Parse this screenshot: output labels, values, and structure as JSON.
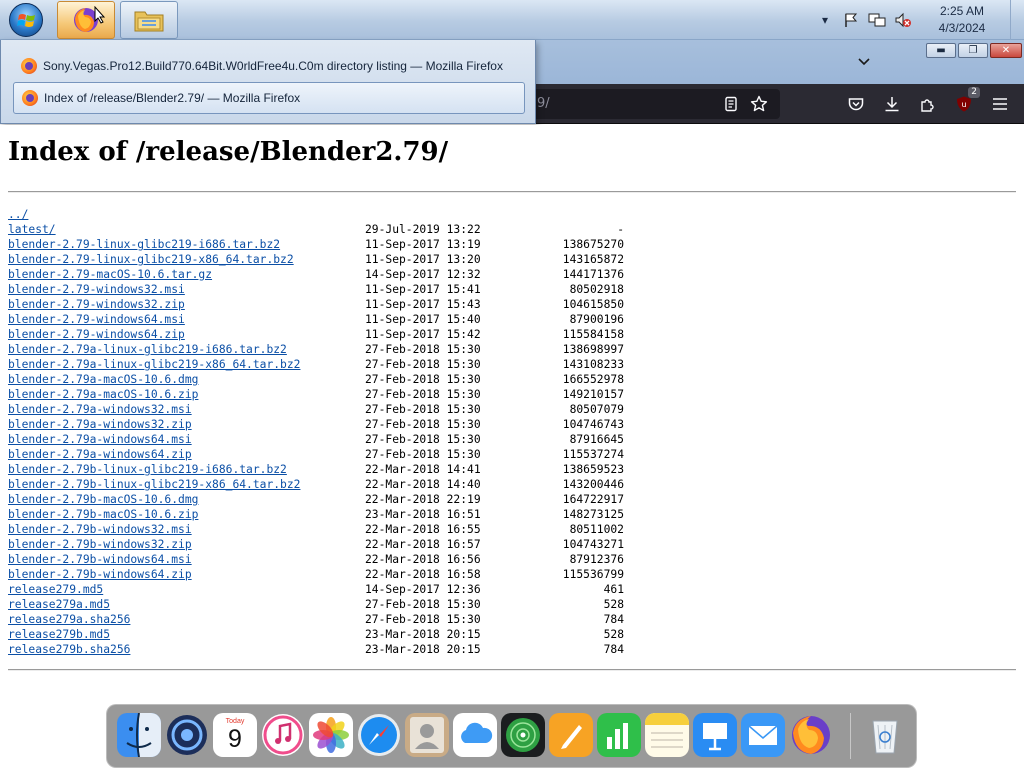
{
  "taskbar": {
    "clock_time": "2:25 AM",
    "clock_date": "4/3/2024"
  },
  "popup": {
    "items": [
      {
        "title": "Sony.Vegas.Pro12.Build770.64Bit.W0rldFree4u.C0m directory listing — Mozilla Firefox"
      },
      {
        "title": "Index of /release/Blender2.79/ — Mozilla Firefox"
      }
    ]
  },
  "navbar": {
    "url_fragment": "9/",
    "extension_badge": "2"
  },
  "page": {
    "title": "Index of /release/Blender2.79/",
    "entries": [
      {
        "name": "../",
        "date": "",
        "size": ""
      },
      {
        "name": "latest/",
        "date": "29-Jul-2019 13:22",
        "size": "-"
      },
      {
        "name": "blender-2.79-linux-glibc219-i686.tar.bz2",
        "date": "11-Sep-2017 13:19",
        "size": "138675270"
      },
      {
        "name": "blender-2.79-linux-glibc219-x86_64.tar.bz2",
        "date": "11-Sep-2017 13:20",
        "size": "143165872"
      },
      {
        "name": "blender-2.79-macOS-10.6.tar.gz",
        "date": "14-Sep-2017 12:32",
        "size": "144171376"
      },
      {
        "name": "blender-2.79-windows32.msi",
        "date": "11-Sep-2017 15:41",
        "size": "80502918"
      },
      {
        "name": "blender-2.79-windows32.zip",
        "date": "11-Sep-2017 15:43",
        "size": "104615850"
      },
      {
        "name": "blender-2.79-windows64.msi",
        "date": "11-Sep-2017 15:40",
        "size": "87900196"
      },
      {
        "name": "blender-2.79-windows64.zip",
        "date": "11-Sep-2017 15:42",
        "size": "115584158"
      },
      {
        "name": "blender-2.79a-linux-glibc219-i686.tar.bz2",
        "date": "27-Feb-2018 15:30",
        "size": "138698997"
      },
      {
        "name": "blender-2.79a-linux-glibc219-x86_64.tar.bz2",
        "date": "27-Feb-2018 15:30",
        "size": "143108233"
      },
      {
        "name": "blender-2.79a-macOS-10.6.dmg",
        "date": "27-Feb-2018 15:30",
        "size": "166552978"
      },
      {
        "name": "blender-2.79a-macOS-10.6.zip",
        "date": "27-Feb-2018 15:30",
        "size": "149210157"
      },
      {
        "name": "blender-2.79a-windows32.msi",
        "date": "27-Feb-2018 15:30",
        "size": "80507079"
      },
      {
        "name": "blender-2.79a-windows32.zip",
        "date": "27-Feb-2018 15:30",
        "size": "104746743"
      },
      {
        "name": "blender-2.79a-windows64.msi",
        "date": "27-Feb-2018 15:30",
        "size": "87916645"
      },
      {
        "name": "blender-2.79a-windows64.zip",
        "date": "27-Feb-2018 15:30",
        "size": "115537274"
      },
      {
        "name": "blender-2.79b-linux-glibc219-i686.tar.bz2",
        "date": "22-Mar-2018 14:41",
        "size": "138659523"
      },
      {
        "name": "blender-2.79b-linux-glibc219-x86_64.tar.bz2",
        "date": "22-Mar-2018 14:40",
        "size": "143200446"
      },
      {
        "name": "blender-2.79b-macOS-10.6.dmg",
        "date": "22-Mar-2018 22:19",
        "size": "164722917"
      },
      {
        "name": "blender-2.79b-macOS-10.6.zip",
        "date": "23-Mar-2018 16:51",
        "size": "148273125"
      },
      {
        "name": "blender-2.79b-windows32.msi",
        "date": "22-Mar-2018 16:55",
        "size": "80511002"
      },
      {
        "name": "blender-2.79b-windows32.zip",
        "date": "22-Mar-2018 16:57",
        "size": "104743271"
      },
      {
        "name": "blender-2.79b-windows64.msi",
        "date": "22-Mar-2018 16:56",
        "size": "87912376"
      },
      {
        "name": "blender-2.79b-windows64.zip",
        "date": "22-Mar-2018 16:58",
        "size": "115536799"
      },
      {
        "name": "release279.md5",
        "date": "14-Sep-2017 12:36",
        "size": "461"
      },
      {
        "name": "release279a.md5",
        "date": "27-Feb-2018 15:30",
        "size": "528"
      },
      {
        "name": "release279a.sha256",
        "date": "27-Feb-2018 15:30",
        "size": "784"
      },
      {
        "name": "release279b.md5",
        "date": "23-Mar-2018 20:15",
        "size": "528"
      },
      {
        "name": "release279b.sha256",
        "date": "23-Mar-2018 20:15",
        "size": "784"
      }
    ]
  },
  "dock": {
    "calendar_month": "Today",
    "calendar_day": "9",
    "apps": [
      "finder-icon",
      "launchpad-icon",
      "calendar-icon",
      "music-icon",
      "photos-icon",
      "safari-icon",
      "contacts-icon",
      "icloud-icon",
      "find-my-icon",
      "pages-icon",
      "numbers-icon",
      "notes-icon",
      "keynote-icon",
      "mail-icon",
      "firefox-icon",
      "trash-icon"
    ]
  },
  "colors": {
    "link": "#0b4fa6",
    "navbar": "#2b2a33",
    "taskbar": "#b7cbe2"
  }
}
